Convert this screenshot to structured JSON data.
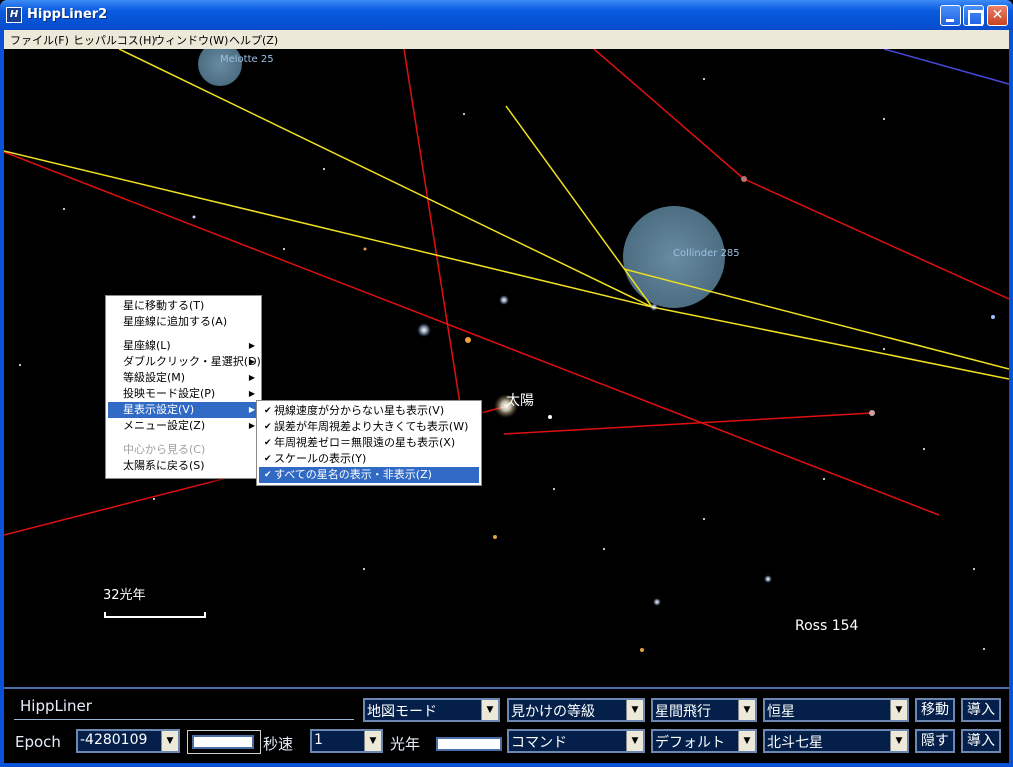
{
  "window": {
    "title": "HippLiner2"
  },
  "menubar": [
    "ファイル(F)",
    "ヒッパルコス(H)",
    "ウィンドウ(W)",
    "ヘルプ(Z)"
  ],
  "sky": {
    "cluster_labels": [
      "Melotte 25",
      "Collinder 285"
    ],
    "sun_label": "太陽",
    "star_label": "Ross 154",
    "scale_label": "32光年"
  },
  "context_menu": {
    "items": [
      "星に移動する(T)",
      "星座線に追加する(A)",
      "星座線(L)",
      "ダブルクリック・星選択(D)",
      "等級設定(M)",
      "投映モード設定(P)",
      "星表示設定(V)",
      "メニュー設定(Z)",
      "中心から見る(C)",
      "太陽系に戻る(S)"
    ]
  },
  "submenu": {
    "items": [
      "視線速度が分からない星も表示(V)",
      "誤差が年周視差より大きくても表示(W)",
      "年周視差ゼロ＝無限遠の星も表示(X)",
      "スケールの表示(Y)",
      "すべての星名の表示・非表示(Z)"
    ]
  },
  "panel": {
    "app_label": "HippLiner",
    "epoch_label": "Epoch",
    "epoch_value": "-4280109",
    "speed_label": "秒速",
    "speed_value": "1",
    "lightyear_label": "光年",
    "combos": {
      "map_mode": "地図モード",
      "magnitude": "見かけの等級",
      "flight": "星間飛行",
      "star_type": "恒星",
      "command": "コマンド",
      "default": "デフォルト",
      "constellation": "北斗七星"
    },
    "buttons": {
      "move": "移動",
      "import1": "導入",
      "hide": "隠す",
      "import2": "導入"
    }
  },
  "colors": {
    "title_bar": "#0653d6",
    "menu_highlight": "#316ac5",
    "line_red": "#e01010",
    "line_yellow": "#f0e020"
  }
}
